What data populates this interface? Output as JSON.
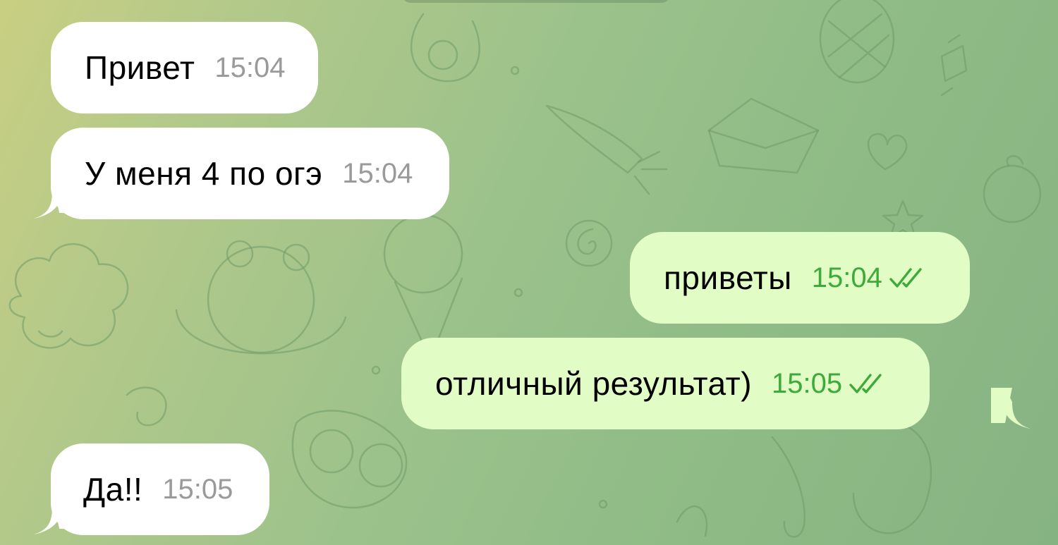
{
  "chat": {
    "background_color": "#9cc28b",
    "incoming_bubble_color": "#ffffff",
    "outgoing_bubble_color": "#e2fcc5",
    "status_icon": "double-check-icon",
    "messages": [
      {
        "direction": "incoming",
        "text": "Привет",
        "time": "15:04"
      },
      {
        "direction": "incoming",
        "text": "У меня 4 по огэ",
        "time": "15:04"
      },
      {
        "direction": "outgoing",
        "text": "приветы",
        "time": "15:04",
        "status": "read"
      },
      {
        "direction": "outgoing",
        "text": "отличный результат)",
        "time": "15:05",
        "status": "read"
      },
      {
        "direction": "incoming",
        "text": "Да!!",
        "time": "15:05"
      }
    ]
  }
}
